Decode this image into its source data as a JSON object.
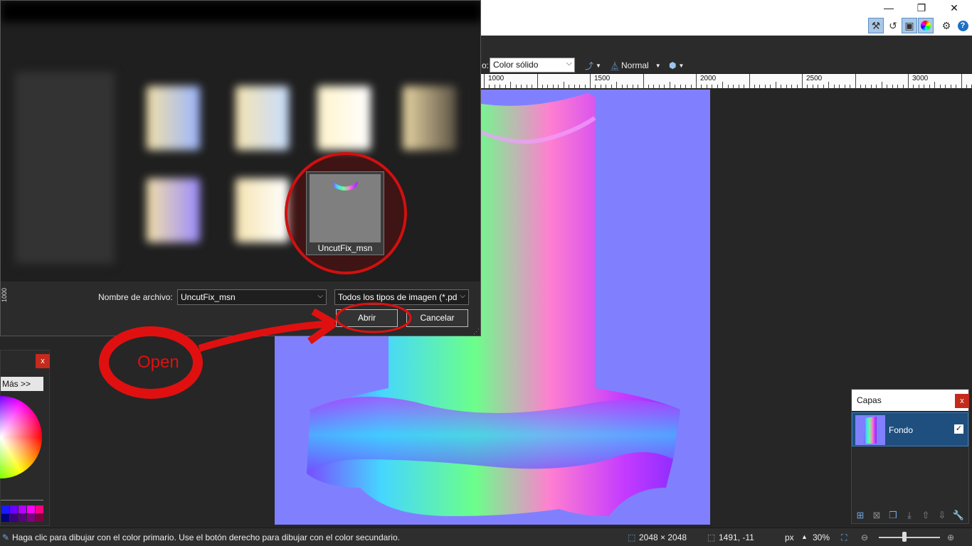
{
  "window": {
    "minimize_icon": "minimize-icon",
    "restore_icon": "restore-icon",
    "close_icon": "close-icon"
  },
  "toolbar": {
    "fill_label": "o:",
    "fill_value": "Color sólido",
    "blend_mode": "Normal",
    "icons": [
      "tools-icon",
      "history-icon",
      "layers-icon",
      "colors-icon",
      "settings-icon",
      "help-icon"
    ]
  },
  "ruler": {
    "labels": [
      "1000",
      "1500",
      "2000",
      "2500",
      "3000"
    ],
    "side_label": "1000"
  },
  "dialog": {
    "selected_file": "UncutFix_msn",
    "filename_label": "Nombre de archivo:",
    "filename_value": "UncutFix_msn",
    "filetype_value": "Todos los tipos de imagen (*.pd",
    "open_button": "Abrir",
    "cancel_button": "Cancelar"
  },
  "annotation": {
    "open_text": "Open",
    "color": "#e01010"
  },
  "colors_panel": {
    "more_button": "Más >>",
    "close": "x",
    "palette": [
      "#1a1aff",
      "#6a00ff",
      "#b400ff",
      "#ff00ff",
      "#ff0080",
      "#000080",
      "#3a0080",
      "#5a0080",
      "#800080",
      "#800040"
    ]
  },
  "layers_panel": {
    "title": "Capas",
    "close": "x",
    "layer_name": "Fondo",
    "layer_visible": "✓"
  },
  "statusbar": {
    "hint": "Haga clic para dibujar con el color primario. Use el botón derecho para dibujar con el color secundario.",
    "image_size": "2048 × 2048",
    "cursor_pos": "1491, -11",
    "unit": "px",
    "zoom": "30%"
  }
}
